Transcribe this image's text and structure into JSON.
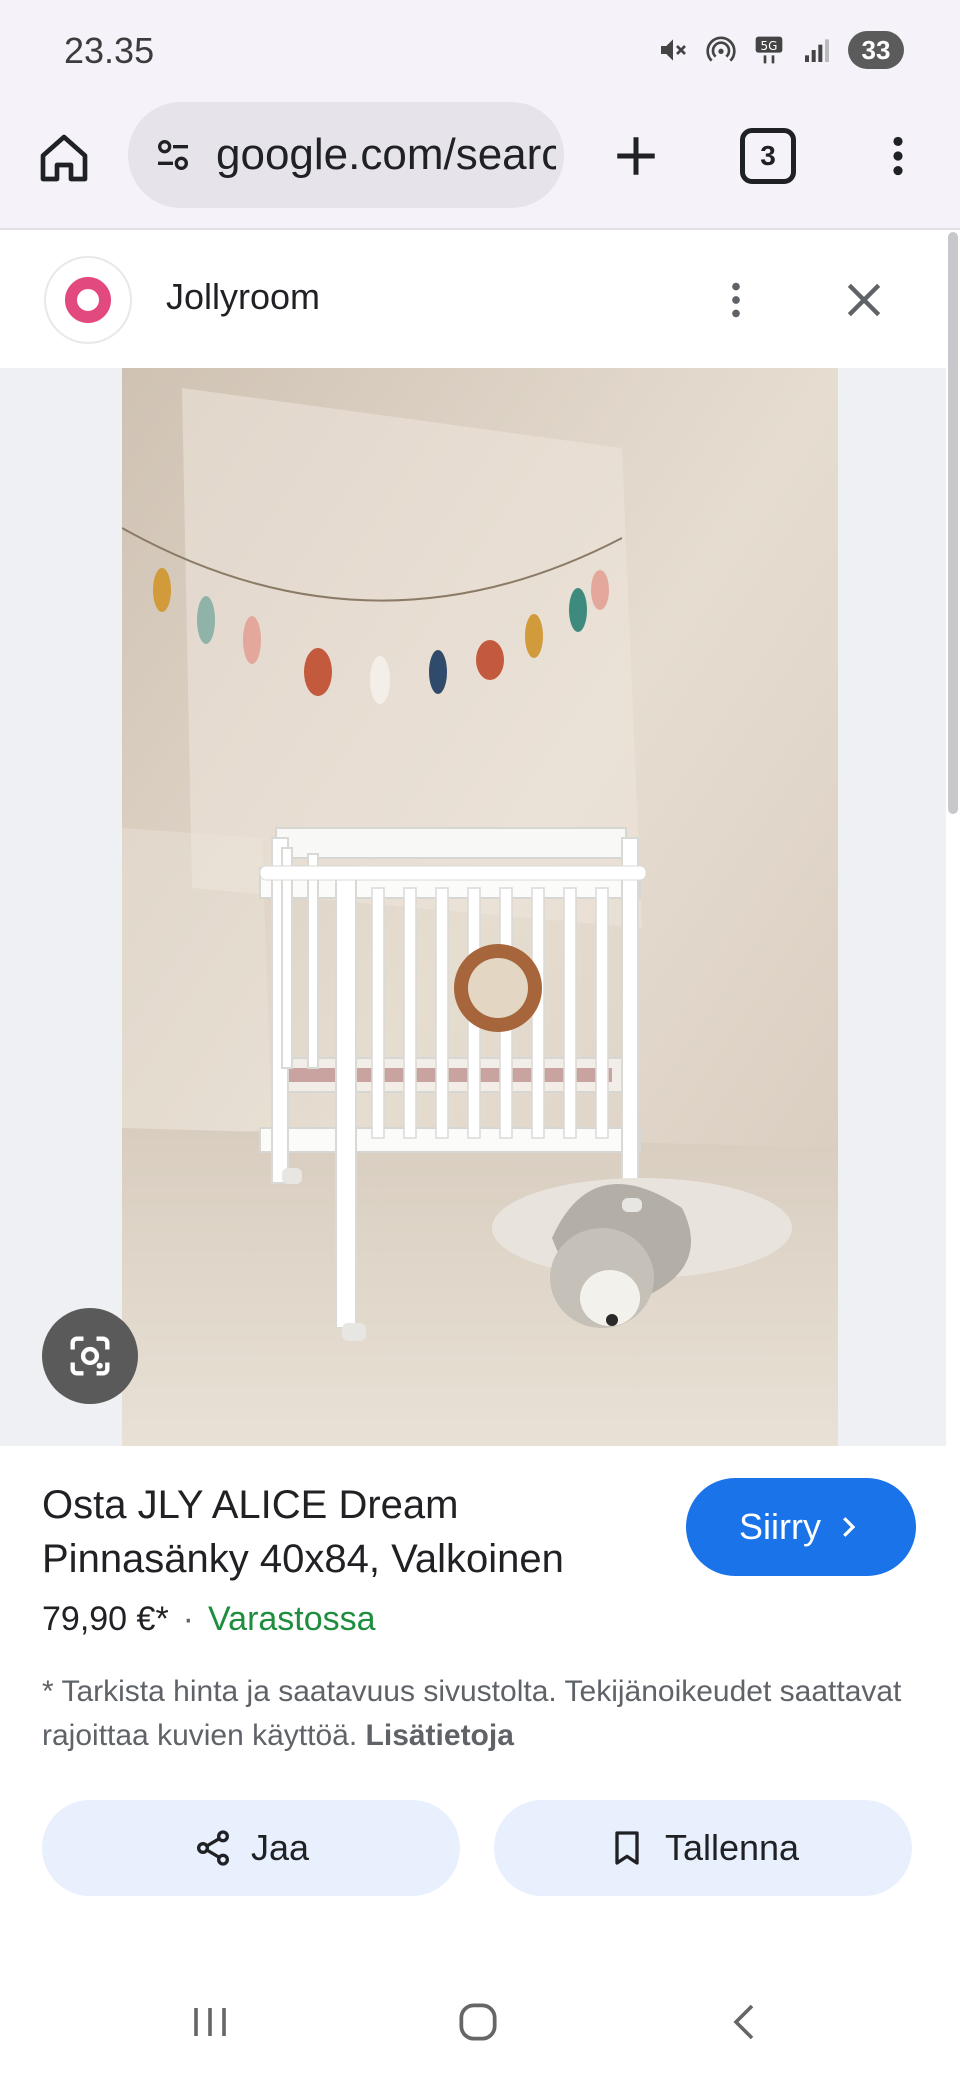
{
  "status_bar": {
    "time": "23.35",
    "battery": "33",
    "icons": [
      "mute-icon",
      "hotspot-icon",
      "5g-icon",
      "signal-icon"
    ]
  },
  "browser": {
    "url": "google.com/search",
    "tab_count": "3",
    "icons": [
      "home-icon",
      "tune-icon",
      "plus-icon",
      "tabs-icon",
      "more-vert-icon"
    ]
  },
  "source": {
    "name": "Jollyroom",
    "logo_color": "#e2497f"
  },
  "product": {
    "title": "Osta JLY ALICE Dream Pinnasänky 40x84, Valkoinen",
    "price": "79,90 €*",
    "separator": "·",
    "availability": "Varastossa",
    "disclaimer": "* Tarkista hinta ja saatavuus sivustolta. Tekijänoikeudet saattavat rajoittaa kuvien käyttöä.",
    "more_info": "Lisätietoja",
    "go_button": "Siirry"
  },
  "actions": {
    "share": "Jaa",
    "save": "Tallenna"
  },
  "colors": {
    "accent": "#1a73e8",
    "in_stock": "#1e8e3e",
    "action_bg": "#e8f0fe"
  }
}
